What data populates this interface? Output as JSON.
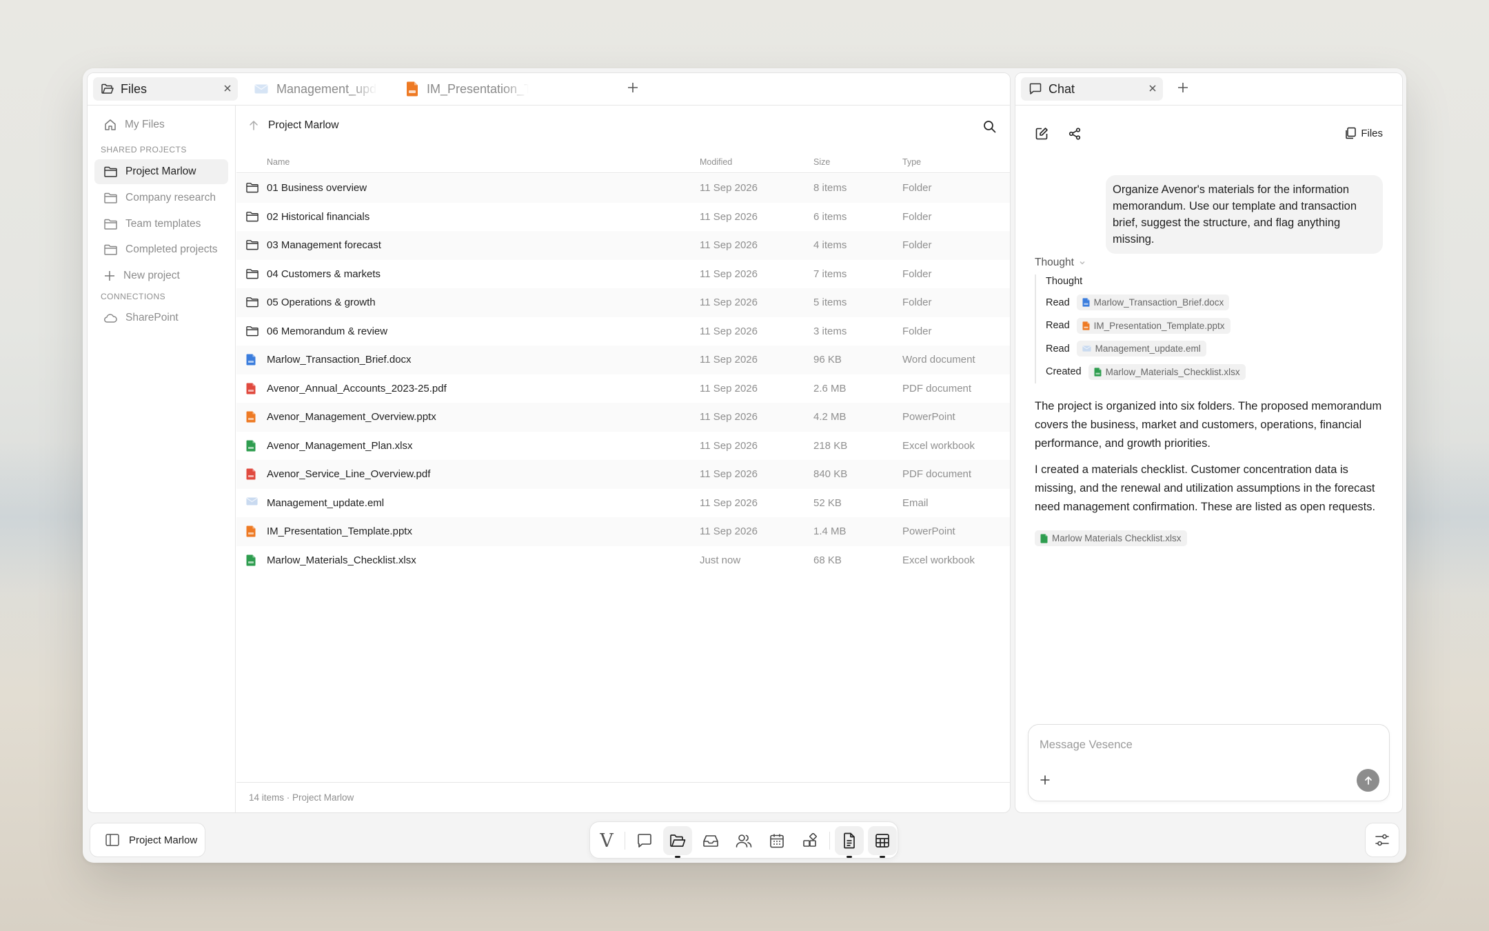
{
  "files_panel": {
    "tabs": [
      {
        "label": "Files",
        "icon": "folder-open-icon"
      },
      {
        "label": "Management_update.eml",
        "icon": "email-file-icon"
      },
      {
        "label": "IM_Presentation_Template.pptx",
        "icon": "pptx-file-icon"
      }
    ],
    "sidebar": {
      "my_files": "My Files",
      "shared_section": "SHARED PROJECTS",
      "projects": [
        "Project Marlow",
        "Company research",
        "Team templates",
        "Completed projects"
      ],
      "new_project": "New project",
      "connections_section": "CONNECTIONS",
      "connections": [
        "SharePoint"
      ]
    },
    "breadcrumb": "Project Marlow",
    "columns": {
      "name": "Name",
      "modified": "Modified",
      "size": "Size",
      "type": "Type"
    },
    "rows": [
      {
        "name": "01 Business overview",
        "modified": "11 Sep 2026",
        "size": "8 items",
        "type": "Folder",
        "kind": "folder"
      },
      {
        "name": "02 Historical financials",
        "modified": "11 Sep 2026",
        "size": "6 items",
        "type": "Folder",
        "kind": "folder"
      },
      {
        "name": "03 Management forecast",
        "modified": "11 Sep 2026",
        "size": "4 items",
        "type": "Folder",
        "kind": "folder"
      },
      {
        "name": "04 Customers & markets",
        "modified": "11 Sep 2026",
        "size": "7 items",
        "type": "Folder",
        "kind": "folder"
      },
      {
        "name": "05 Operations & growth",
        "modified": "11 Sep 2026",
        "size": "5 items",
        "type": "Folder",
        "kind": "folder"
      },
      {
        "name": "06 Memorandum & review",
        "modified": "11 Sep 2026",
        "size": "3 items",
        "type": "Folder",
        "kind": "folder"
      },
      {
        "name": "Marlow_Transaction_Brief.docx",
        "modified": "11 Sep 2026",
        "size": "96 KB",
        "type": "Word document",
        "kind": "docx"
      },
      {
        "name": "Avenor_Annual_Accounts_2023-25.pdf",
        "modified": "11 Sep 2026",
        "size": "2.6 MB",
        "type": "PDF document",
        "kind": "pdf"
      },
      {
        "name": "Avenor_Management_Overview.pptx",
        "modified": "11 Sep 2026",
        "size": "4.2 MB",
        "type": "PowerPoint",
        "kind": "pptx"
      },
      {
        "name": "Avenor_Management_Plan.xlsx",
        "modified": "11 Sep 2026",
        "size": "218 KB",
        "type": "Excel workbook",
        "kind": "xlsx"
      },
      {
        "name": "Avenor_Service_Line_Overview.pdf",
        "modified": "11 Sep 2026",
        "size": "840 KB",
        "type": "PDF document",
        "kind": "pdf"
      },
      {
        "name": "Management_update.eml",
        "modified": "11 Sep 2026",
        "size": "52 KB",
        "type": "Email",
        "kind": "eml"
      },
      {
        "name": "IM_Presentation_Template.pptx",
        "modified": "11 Sep 2026",
        "size": "1.4 MB",
        "type": "PowerPoint",
        "kind": "pptx"
      },
      {
        "name": "Marlow_Materials_Checklist.xlsx",
        "modified": "Just now",
        "size": "68 KB",
        "type": "Excel workbook",
        "kind": "xlsx"
      }
    ],
    "status": "14 items · Project Marlow"
  },
  "chat_panel": {
    "tab_label": "Chat",
    "files_link": "Files",
    "user_message": "Organize Avenor's materials for the information memorandum. Use our template and transaction brief, suggest the structure, and flag anything missing.",
    "thought_toggle": "Thought",
    "thought_title": "Thought",
    "steps": [
      {
        "action": "Read",
        "file": "Marlow_Transaction_Brief.docx",
        "kind": "docx"
      },
      {
        "action": "Read",
        "file": "IM_Presentation_Template.pptx",
        "kind": "pptx"
      },
      {
        "action": "Read",
        "file": "Management_update.eml",
        "kind": "eml"
      },
      {
        "action": "Created",
        "file": "Marlow_Materials_Checklist.xlsx",
        "kind": "xlsx"
      }
    ],
    "answer_p1": "The project is organized into six folders. The proposed memorandum covers the business, market and customers, operations, financial performance, and growth priorities.",
    "answer_p2": "I created a materials checklist. Customer concentration data is missing, and the renewal and utilization assumptions in the forecast need management confirmation. These are listed as open requests.",
    "attachment": "Marlow Materials Checklist.xlsx",
    "composer_placeholder": "Message Vesence"
  },
  "bottom_bar": {
    "project_label": "Project Marlow",
    "dock_logo": "V"
  },
  "colors": {
    "docx": "#3b7ddd",
    "pdf": "#e04a3f",
    "pptx": "#ee7a24",
    "xlsx": "#2e9d4f",
    "eml": "#c9daf0"
  }
}
